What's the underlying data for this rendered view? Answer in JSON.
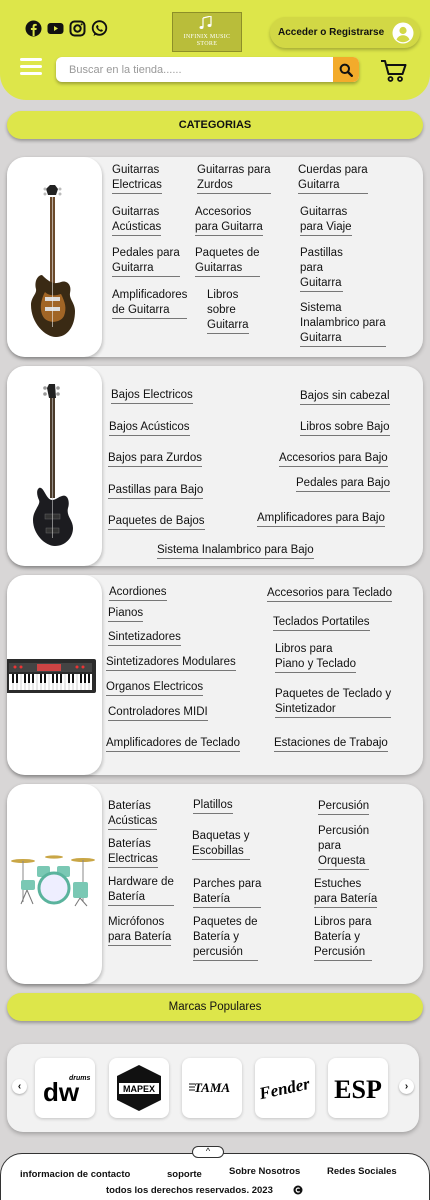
{
  "header": {
    "logo_line1": "INFINIX MUSIC",
    "logo_line2": "STORE",
    "login_label": "Acceder o Registrarse",
    "search_placeholder": "Buscar en la tienda......"
  },
  "categories_title": "CATEGORIAS",
  "guitar_links": [
    "Guitarras\nElectricas",
    "Guitarras para\nZurdos",
    "Cuerdas para\nGuitarra",
    "Guitarras\nAcústicas",
    "Accesorios\npara Guitarra",
    "Guitarras\npara Viaje",
    "Pedales para\nGuitarra",
    "Paquetes de\nGuitarras",
    "Pastillas\npara\nGuitarra",
    "Amplificadores\nde Guitarra",
    "Libros\nsobre\nGuitarra",
    "Sistema\nInalambrico para\nGuitarra"
  ],
  "bass_links": [
    "Bajos Electricos",
    "Bajos sin cabezal",
    "Bajos Acústicos",
    "Libros sobre Bajo",
    "Bajos para Zurdos",
    "Accesorios para Bajo",
    "Pastillas para Bajo",
    "Pedales para Bajo",
    "Paquetes de Bajos",
    "Amplificadores para Bajo",
    "Sistema Inalambrico para Bajo"
  ],
  "keys_links": [
    "Acordiones",
    "Accesorios para Teclado",
    "Pianos",
    "Teclados Portatiles",
    "Sintetizadores",
    "Libros para\nPiano y Teclado",
    "Sintetizadores Modulares",
    "Organos Electricos",
    "Paquetes de Teclado y\nSintetizador",
    "Controladores MIDI",
    "Amplificadores de Teclado",
    "Estaciones de Trabajo"
  ],
  "drum_links": [
    "Baterías\nAcústicas",
    "Platillos",
    "Percusión",
    "Baquetas y\nEscobillas",
    "Baterías\nElectricas",
    "Percusión\npara\nOrquesta",
    "Hardware de\nBatería",
    "Parches para\nBatería",
    "Estuches\npara Batería",
    "Micrófonos\npara Batería",
    "Paquetes de\nBatería y\npercusión",
    "Libros para\nBatería y\nPercusión"
  ],
  "brands_title": "Marcas Populares",
  "brands": [
    "dw",
    "MAPEX",
    "TAMA",
    "Fender",
    "ESP"
  ],
  "footer": {
    "links": [
      "informacion de contacto",
      "soporte",
      "Sobre Nosotros",
      "Redes Sociales"
    ],
    "copyright": "todos los derechos reservados.  2023"
  },
  "colors": {
    "accent": "#dde64a",
    "search_button": "#f3ab2b",
    "background": "#d8d6d6"
  },
  "icons": [
    "facebook-icon",
    "youtube-icon",
    "instagram-icon",
    "whatsapp-icon",
    "user-icon",
    "menu-icon",
    "search-icon",
    "cart-icon",
    "copyright-icon",
    "chevron-up-icon",
    "chevron-left-icon",
    "chevron-right-icon"
  ]
}
